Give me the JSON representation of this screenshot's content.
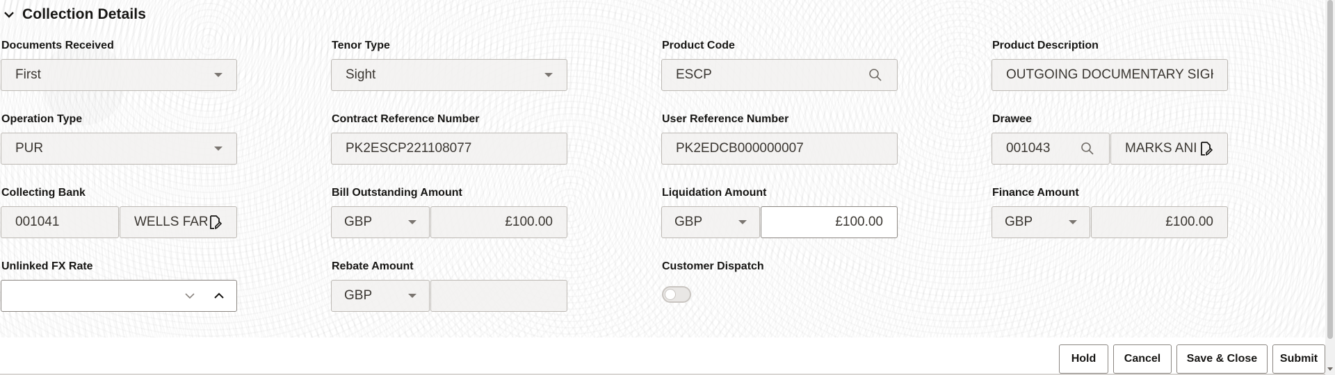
{
  "section": {
    "title": "Collection Details"
  },
  "fields": {
    "documents_received": {
      "label": "Documents Received",
      "value": "First"
    },
    "tenor_type": {
      "label": "Tenor Type",
      "value": "Sight"
    },
    "product_code": {
      "label": "Product Code",
      "value": "ESCP"
    },
    "product_description": {
      "label": "Product Description",
      "value": "OUTGOING DOCUMENTARY SIGHT"
    },
    "operation_type": {
      "label": "Operation Type",
      "value": "PUR"
    },
    "contract_reference_number": {
      "label": "Contract Reference Number",
      "value": "PK2ESCP221108077"
    },
    "user_reference_number": {
      "label": "User Reference Number",
      "value": "PK2EDCB000000007"
    },
    "drawee": {
      "label": "Drawee",
      "code": "001043",
      "name": "MARKS ANI"
    },
    "collecting_bank": {
      "label": "Collecting Bank",
      "code": "001041",
      "name": "WELLS FAR"
    },
    "bill_outstanding_amount": {
      "label": "Bill Outstanding Amount",
      "currency": "GBP",
      "amount": "£100.00"
    },
    "liquidation_amount": {
      "label": "Liquidation Amount",
      "currency": "GBP",
      "amount": "£100.00"
    },
    "finance_amount": {
      "label": "Finance Amount",
      "currency": "GBP",
      "amount": "£100.00"
    },
    "unlinked_fx_rate": {
      "label": "Unlinked FX Rate",
      "value": ""
    },
    "rebate_amount": {
      "label": "Rebate Amount",
      "currency": "GBP",
      "amount": ""
    },
    "customer_dispatch": {
      "label": "Customer Dispatch",
      "enabled": false
    }
  },
  "buttons": {
    "hold": "Hold",
    "cancel": "Cancel",
    "save_close": "Save & Close",
    "submit": "Submit"
  }
}
